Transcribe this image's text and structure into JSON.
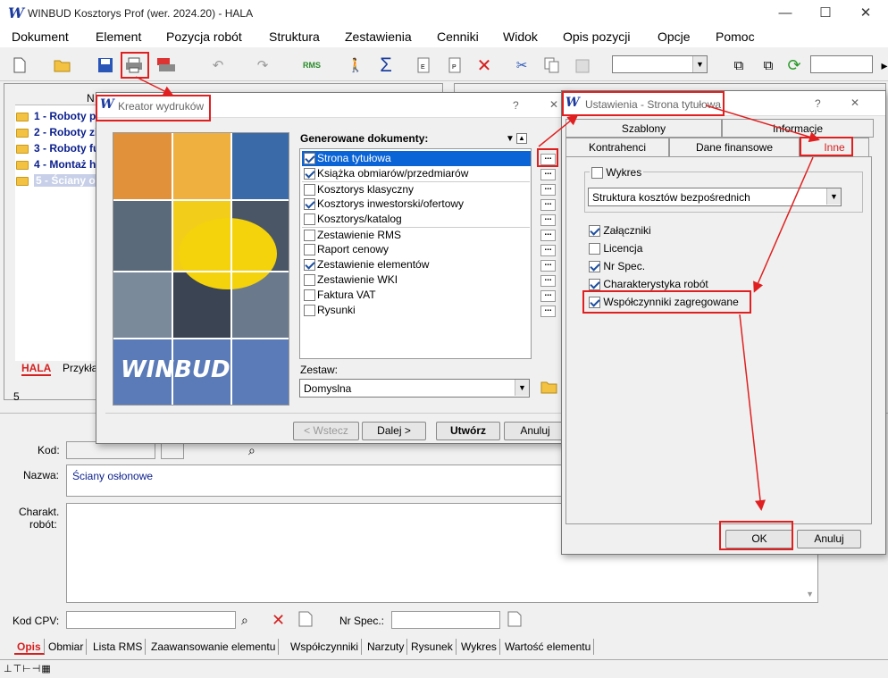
{
  "window": {
    "title": "WINBUD Kosztorys Prof (wer. 2024.20) - HALA",
    "min": "—",
    "max": "☐",
    "close": "✕"
  },
  "menu": [
    "Dokument",
    "Element",
    "Pozycja robót",
    "Struktura",
    "Zestawienia",
    "Cenniki",
    "Widok",
    "Opis pozycji",
    "Opcje",
    "Pomoc"
  ],
  "tree": {
    "header": "N",
    "items": [
      "1 - Roboty p",
      "2 - Roboty zi",
      "3 - Roboty fu",
      "4 - Montaż h",
      "5 - Ściany os"
    ],
    "tabs": [
      "HALA",
      "Przykła"
    ],
    "count": "5"
  },
  "kreator": {
    "title": "Kreator wydruków",
    "help": "?",
    "close": "✕",
    "logo": "WINBUD",
    "docs_label": "Generowane dokumenty:",
    "docs": [
      {
        "label": "Strona tytułowa",
        "checked": true
      },
      {
        "label": "Książka obmiarów/przedmiarów",
        "checked": true
      },
      {
        "label": "Kosztorys klasyczny",
        "checked": false
      },
      {
        "label": "Kosztorys inwestorski/ofertowy",
        "checked": true
      },
      {
        "label": "Kosztorys/katalog",
        "checked": false
      },
      {
        "label": "Zestawienie RMS",
        "checked": false
      },
      {
        "label": "Raport cenowy",
        "checked": false
      },
      {
        "label": "Zestawienie elementów",
        "checked": true
      },
      {
        "label": "Zestawienie WKI",
        "checked": false
      },
      {
        "label": "Faktura VAT",
        "checked": false
      },
      {
        "label": "Rysunki",
        "checked": false
      }
    ],
    "dots": "...",
    "zestaw_label": "Zestaw:",
    "zestaw_value": "Domyslna",
    "buttons": {
      "back": "< Wstecz",
      "next": "Dalej >",
      "create": "Utwórz",
      "cancel": "Anuluj"
    }
  },
  "ustawienia": {
    "title": "Ustawienia - Strona tytułowa",
    "help": "?",
    "close": "✕",
    "tabs_row1": [
      "Szablony",
      "Informacje"
    ],
    "tabs_row2": [
      "Kontrahenci",
      "Dane finansowe",
      "Inne"
    ],
    "wykres_label": "Wykres",
    "wykres_value": "Struktura kosztów bezpośrednich",
    "options": [
      {
        "label": "Załączniki",
        "checked": true
      },
      {
        "label": "Licencja",
        "checked": false
      },
      {
        "label": "Nr Spec.",
        "checked": true
      },
      {
        "label": "Charakterystyka robót",
        "checked": true
      },
      {
        "label": "Współczynniki zagregowane",
        "checked": true
      }
    ],
    "ok": "OK",
    "cancel": "Anuluj"
  },
  "form": {
    "kod_label": "Kod:",
    "nazwa_label": "Nazwa:",
    "nazwa_value": "Ściany osłonowe",
    "charakt_label1": "Charakt.",
    "charakt_label2": "robót:",
    "kodcpv_label": "Kod CPV:",
    "nrspec_label": "Nr Spec.:"
  },
  "bottom_tabs": [
    "Opis",
    "Obmiar",
    "Lista RMS",
    "Zaawansowanie elementu",
    "Współczynniki",
    "Narzuty",
    "Rysunek",
    "Wykres",
    "Wartość elementu"
  ],
  "colors": {
    "accent": "#e02020",
    "selection": "#0a64d6",
    "tree_text": "#0a1f8c"
  }
}
